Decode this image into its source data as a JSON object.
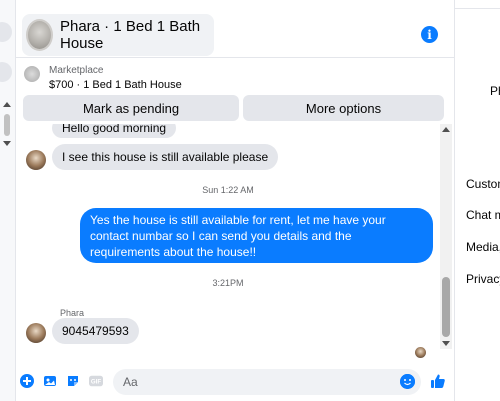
{
  "header": {
    "title": "Phara · 1 Bed 1 Bath House",
    "info_icon": "info-icon"
  },
  "listing": {
    "label": "Marketplace",
    "price_title": "$700 · 1 Bed 1 Bath House"
  },
  "actions": {
    "pending_label": "Mark as pending",
    "more_label": "More options"
  },
  "messages": {
    "partial_first": "Hello good morning",
    "m1": "I see this house is still available please",
    "ts1": "Sun 1:22 AM",
    "out1": "Yes the house is still available for rent, let me have your contact numbar so I can send you details and the requirements about the house!!",
    "ts2": "3:21PM",
    "sender": "Phara",
    "m2": "9045479593"
  },
  "composer": {
    "placeholder": "Aa",
    "icons": [
      "plus-circle-icon",
      "photo-icon",
      "sticker-icon",
      "gif-icon",
      "emoji-icon",
      "thumbs-up-icon"
    ]
  },
  "right_panel": {
    "item_top": "Ph",
    "items": [
      "Custom",
      "Chat m",
      "Media,",
      "Privacy"
    ]
  },
  "colors": {
    "accent": "#0a7cff",
    "bubble_in": "#e4e6eb",
    "muted_text": "#65676b"
  }
}
